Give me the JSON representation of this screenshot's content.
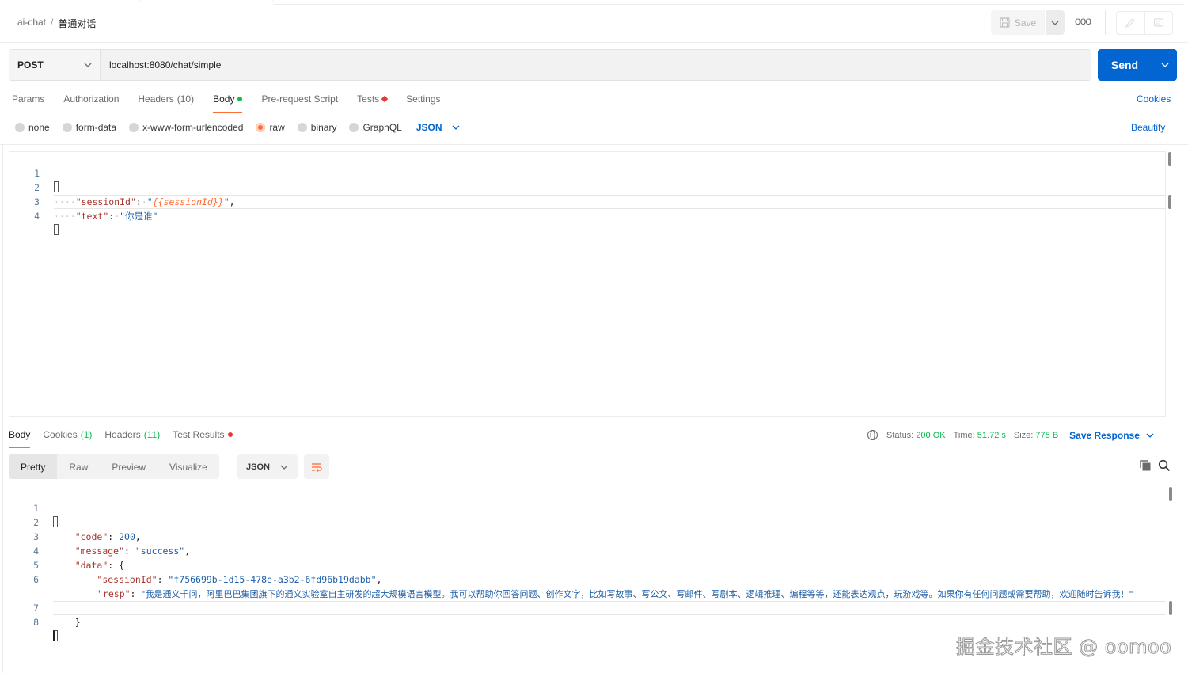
{
  "header": {
    "collection": "ai-chat",
    "separator": "/",
    "request_name": "普通对话",
    "save_label": "Save",
    "more_label": "ooo"
  },
  "request": {
    "method": "POST",
    "url": "localhost:8080/chat/simple",
    "send_label": "Send"
  },
  "request_tabs": [
    {
      "label": "Params",
      "count": ""
    },
    {
      "label": "Authorization",
      "count": ""
    },
    {
      "label": "Headers",
      "count": "(10)"
    },
    {
      "label": "Body",
      "count": "",
      "active": true,
      "indicator": "green-dot"
    },
    {
      "label": "Pre-request Script",
      "count": ""
    },
    {
      "label": "Tests",
      "count": "",
      "indicator": "red-diamond"
    },
    {
      "label": "Settings",
      "count": ""
    }
  ],
  "cookies_label": "Cookies",
  "body_types": [
    {
      "label": "none",
      "selected": false
    },
    {
      "label": "form-data",
      "selected": false
    },
    {
      "label": "x-www-form-urlencoded",
      "selected": false
    },
    {
      "label": "raw",
      "selected": true
    },
    {
      "label": "binary",
      "selected": false
    },
    {
      "label": "GraphQL",
      "selected": false
    }
  ],
  "raw_language": "JSON",
  "beautify_label": "Beautify",
  "request_body": {
    "line_numbers": [
      "1",
      "2",
      "3",
      "4"
    ],
    "open_brace": "{",
    "close_brace": "}",
    "session_key": "\"sessionId\"",
    "session_value_open": "\"",
    "session_value_var": "{{sessionId}}",
    "session_value_close": "\"",
    "text_key": "\"text\"",
    "text_value": "\"你是谁\""
  },
  "response_tabs": [
    {
      "label": "Body",
      "count": "",
      "active": true
    },
    {
      "label": "Cookies",
      "count": "(1)"
    },
    {
      "label": "Headers",
      "count": "(11)"
    },
    {
      "label": "Test Results",
      "count": "",
      "indicator": "red-dot"
    }
  ],
  "response_meta": {
    "status_label": "Status:",
    "status_value": "200 OK",
    "time_label": "Time:",
    "time_value": "51.72 s",
    "size_label": "Size:",
    "size_value": "775 B",
    "save_response_label": "Save Response"
  },
  "view_tabs": [
    "Pretty",
    "Raw",
    "Preview",
    "Visualize"
  ],
  "response_format": "JSON",
  "response_body": {
    "line_numbers": [
      "1",
      "2",
      "3",
      "4",
      "5",
      "6",
      "7",
      "8"
    ],
    "open_brace": "{",
    "code_key": "\"code\"",
    "code_value": "200",
    "message_key": "\"message\"",
    "message_value": "\"success\"",
    "data_key": "\"data\"",
    "session_key": "\"sessionId\"",
    "session_value": "\"f756699b-1d15-478e-a3b2-6fd96b19dabb\"",
    "resp_key": "\"resp\"",
    "resp_value": "\"我是通义千问，阿里巴巴集团旗下的通义实验室自主研发的超大规模语言模型。我可以帮助你回答问题、创作文字，比如写故事、写公文、写邮件、写剧本、逻辑推理、编程等等，还能表达观点，玩游戏等。如果你有任何问题或需要帮助，欢迎随时告诉我！\"",
    "inner_close": "}",
    "close_brace": "}"
  },
  "watermark": "掘金技术社区 @ oomoo",
  "colors": {
    "accent_orange": "#ff6c37",
    "link_blue": "#0265d2",
    "success_green": "#0cbb52",
    "error_red": "#e53935"
  }
}
